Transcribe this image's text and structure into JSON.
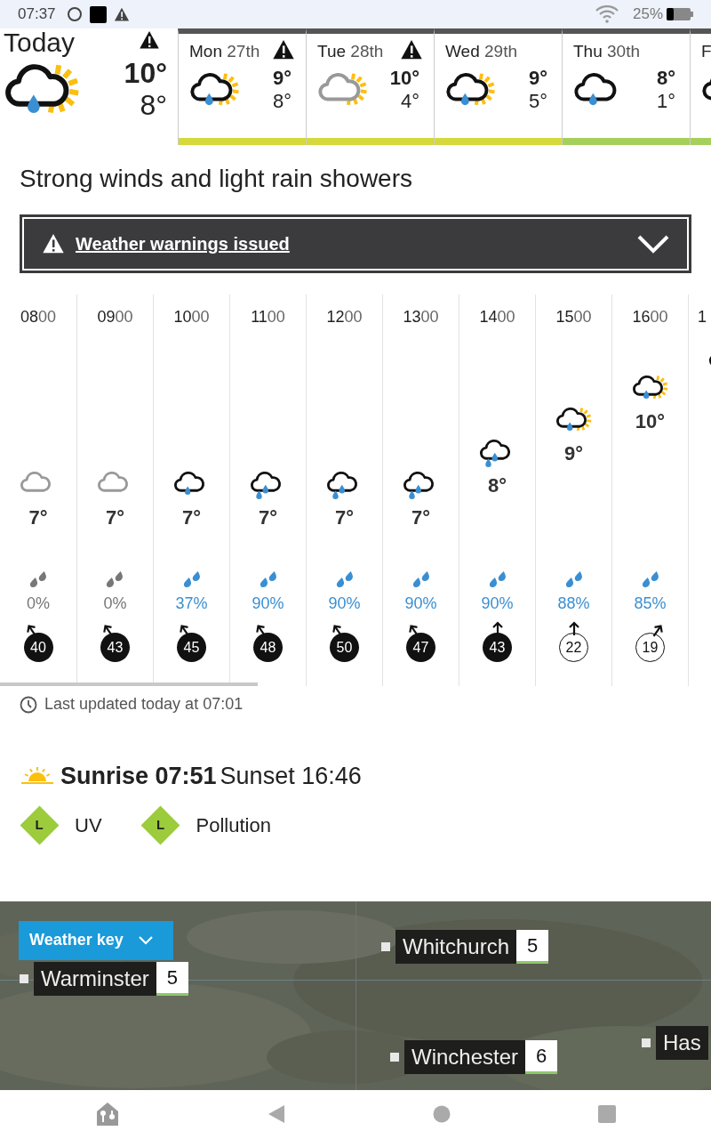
{
  "status_bar": {
    "time": "07:37",
    "battery": "25%"
  },
  "today": {
    "label": "Today",
    "warning": true,
    "kind": "rain-sun",
    "high": "10°",
    "low": "8°"
  },
  "days": [
    {
      "day": "Mon",
      "date": "27th",
      "warning": true,
      "kind": "rain-sun",
      "high": "9°",
      "low": "8°",
      "color": "#d5d93c"
    },
    {
      "day": "Tue",
      "date": "28th",
      "warning": true,
      "kind": "cloud-sun",
      "high": "10°",
      "low": "4°",
      "color": "#d5d93c"
    },
    {
      "day": "Wed",
      "date": "29th",
      "warning": false,
      "kind": "rain-sun",
      "high": "9°",
      "low": "5°",
      "color": "#d5d93c"
    },
    {
      "day": "Thu",
      "date": "30th",
      "warning": false,
      "kind": "light-rain",
      "high": "8°",
      "low": "1°",
      "color": "#a6d05c"
    },
    {
      "day": "F",
      "kind": "rain-sun",
      "color": "#a6d05c"
    }
  ],
  "summary": "Strong winds and light rain showers",
  "warnings": {
    "label": "Weather warnings issued",
    "expanded": false
  },
  "hours": [
    {
      "hour": "08",
      "minutes": "00",
      "kind": "cloud",
      "temp": "7°",
      "precip": "0%",
      "color": "#777777",
      "wind": {
        "speed": "40",
        "strong": true,
        "kind": "nw"
      }
    },
    {
      "hour": "09",
      "minutes": "00",
      "kind": "cloud",
      "temp": "7°",
      "precip": "0%",
      "color": "#777777",
      "wind": {
        "speed": "43",
        "strong": true,
        "kind": "nw"
      }
    },
    {
      "hour": "10",
      "minutes": "00",
      "kind": "light-rain",
      "temp": "7°",
      "precip": "37%",
      "color": "#3a8fd2",
      "wind": {
        "speed": "45",
        "strong": true,
        "kind": "nw"
      }
    },
    {
      "hour": "11",
      "minutes": "00",
      "kind": "rain",
      "temp": "7°",
      "precip": "90%",
      "color": "#3a8fd2",
      "wind": {
        "speed": "48",
        "strong": true,
        "kind": "nw"
      }
    },
    {
      "hour": "12",
      "minutes": "00",
      "kind": "rain",
      "temp": "7°",
      "precip": "90%",
      "color": "#3a8fd2",
      "wind": {
        "speed": "50",
        "strong": true,
        "kind": "nw"
      }
    },
    {
      "hour": "13",
      "minutes": "00",
      "kind": "rain",
      "temp": "7°",
      "precip": "90%",
      "color": "#3a8fd2",
      "wind": {
        "speed": "47",
        "strong": true,
        "kind": "nw"
      }
    },
    {
      "hour": "14",
      "minutes": "00",
      "kind": "rain",
      "temp": "8°",
      "precip": "90%",
      "color": "#3a8fd2",
      "wind": {
        "speed": "43",
        "strong": true,
        "kind": "n"
      }
    },
    {
      "hour": "15",
      "minutes": "00",
      "kind": "rain-sun",
      "temp": "9°",
      "precip": "88%",
      "color": "#3a8fd2",
      "wind": {
        "speed": "22",
        "strong": false,
        "kind": "n"
      }
    },
    {
      "hour": "16",
      "minutes": "00",
      "kind": "rain-sun",
      "temp": "10°",
      "precip": "85%",
      "color": "#3a8fd2",
      "wind": {
        "speed": "19",
        "strong": false,
        "kind": "ne"
      }
    },
    {
      "hour": "1",
      "kind": "rain-sun"
    }
  ],
  "last_updated": "Last updated today at 07:01",
  "sunrise": "Sunrise 07:51",
  "sunset": "Sunset 16:46",
  "indices": [
    {
      "letter": "L",
      "label": "UV",
      "color": "#9ccc3c"
    },
    {
      "letter": "L",
      "label": "Pollution",
      "color": "#9ccc3c"
    }
  ],
  "map": {
    "kind": "picture",
    "key_button": "Weather key",
    "places": [
      {
        "name": "Warminster",
        "value": "5"
      },
      {
        "name": "Whitchurch",
        "value": "5"
      },
      {
        "name": "Winchester",
        "value": "6"
      },
      {
        "name": "Has"
      }
    ]
  }
}
